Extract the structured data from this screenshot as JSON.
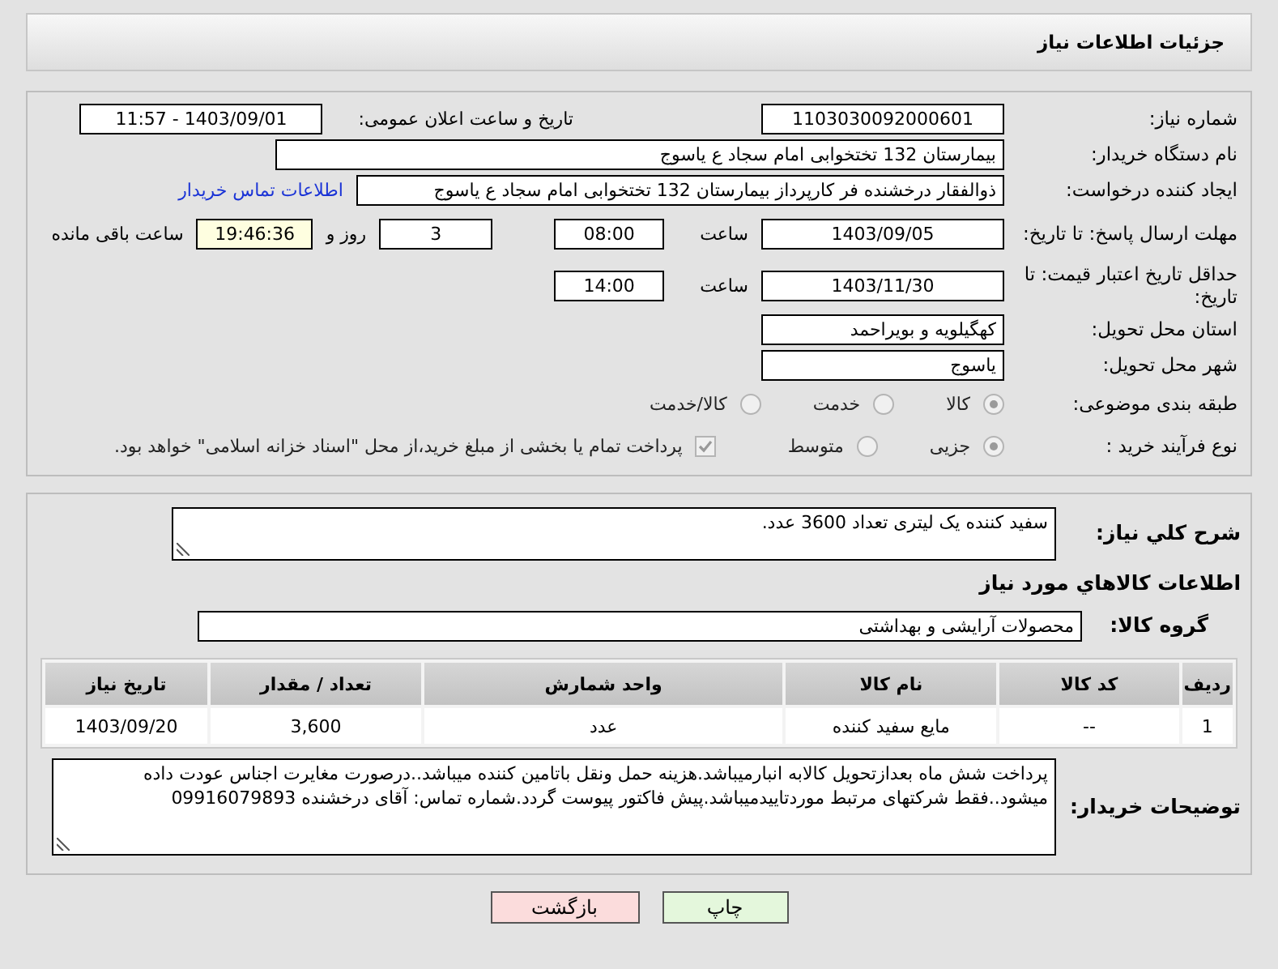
{
  "header": {
    "title": "جزئیات اطلاعات نیاز"
  },
  "details": {
    "need_number": {
      "label": "شماره نیاز:",
      "value": "1103030092000601"
    },
    "announce": {
      "label": "تاریخ و ساعت اعلان عمومی:",
      "value": "1403/09/01 - 11:57"
    },
    "buyer_org": {
      "label": "نام دستگاه خریدار:",
      "value": "بیمارستان 132 تختخوابی امام سجاد  ع  یاسوج"
    },
    "requester": {
      "label": "ایجاد کننده درخواست:",
      "value": "ذوالفقار درخشنده فر کارپرداز بیمارستان 132 تختخوابی امام سجاد  ع  یاسوج",
      "link": "اطلاعات تماس خریدار"
    },
    "reply_deadline": {
      "label": "مهلت ارسال پاسخ: تا تاریخ:",
      "date": "1403/09/05",
      "time_label": "ساعت",
      "time": "08:00",
      "days": "3",
      "days_label": "روز و",
      "remaining": "19:46:36",
      "remaining_label": "ساعت باقی مانده"
    },
    "price_validity": {
      "label": "حداقل تاریخ اعتبار قیمت: تا تاریخ:",
      "date": "1403/11/30",
      "time_label": "ساعت",
      "time": "14:00"
    },
    "province": {
      "label": "استان محل تحویل:",
      "value": "کهگیلویه و بویراحمد"
    },
    "city": {
      "label": "شهر محل تحویل:",
      "value": "یاسوج"
    },
    "category": {
      "label": "طبقه بندی موضوعی:",
      "options": [
        {
          "label": "کالا",
          "selected": true
        },
        {
          "label": "خدمت",
          "selected": false
        },
        {
          "label": "کالا/خدمت",
          "selected": false
        }
      ]
    },
    "process": {
      "label": "نوع فرآیند خرید :",
      "options": [
        {
          "label": "جزیی",
          "selected": true
        },
        {
          "label": "متوسط",
          "selected": false
        }
      ],
      "treasury": {
        "checked": true,
        "label": "پرداخت تمام یا بخشی از مبلغ خرید،از محل \"اسناد خزانه اسلامی\" خواهد بود."
      }
    }
  },
  "needs": {
    "summary": {
      "label": "شرح کلي نياز:",
      "value": "سفید کننده یک لیتری تعداد 3600 عدد."
    },
    "section_title": "اطلاعات کالاهاي مورد نياز",
    "group": {
      "label": "گروه کالا:",
      "value": "محصولات آرایشی و بهداشتی"
    },
    "table": {
      "columns": [
        "ردیف",
        "کد کالا",
        "نام کالا",
        "واحد شمارش",
        "تعداد / مقدار",
        "تاریخ نیاز"
      ],
      "rows": [
        [
          "1",
          "--",
          "مایع سفید کننده",
          "عدد",
          "3,600",
          "1403/09/20"
        ]
      ]
    },
    "buyer_notes": {
      "label": "توضیحات خریدار:",
      "value": "پرداخت شش ماه بعدازتحویل کالابه انبارمیباشد.هزینه حمل ونقل باتامین کننده میباشد..درصورت مغایرت اجناس عودت داده میشود..فقط شرکتهای مرتبط موردتاییدمیباشد.پیش فاکتور پیوست گردد.شماره تماس: آقای درخشنده 09916079893"
    }
  },
  "buttons": [
    {
      "kind": "print",
      "label": "چاپ"
    },
    {
      "kind": "back",
      "label": "بازگشت"
    }
  ]
}
